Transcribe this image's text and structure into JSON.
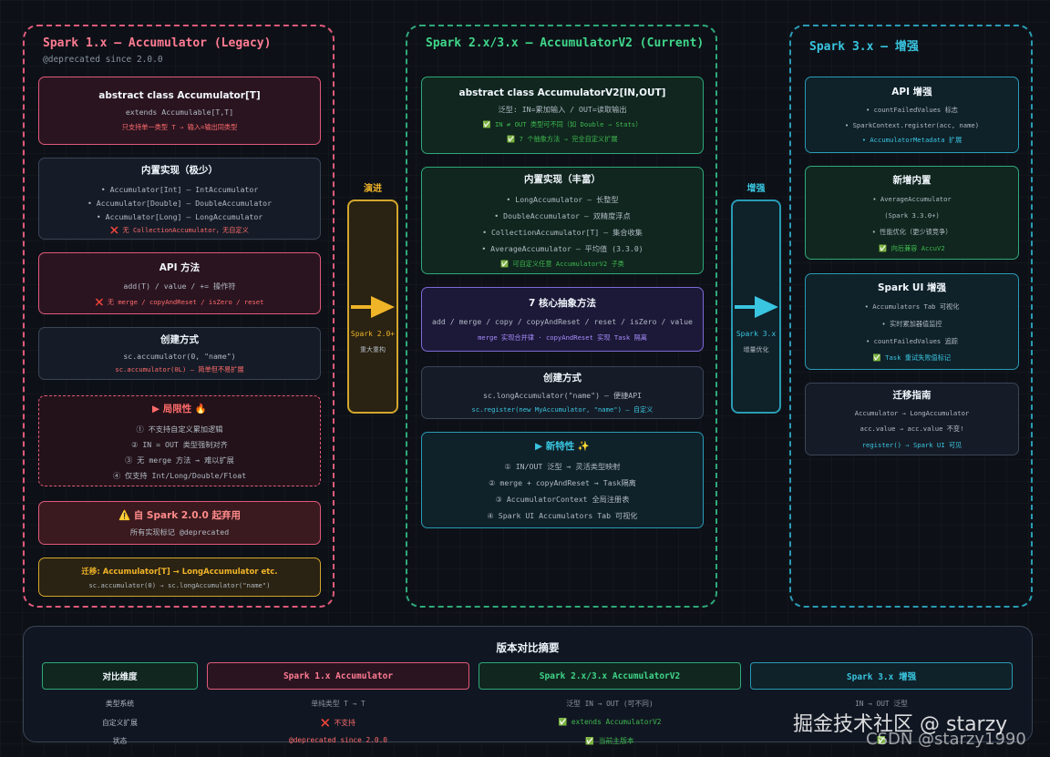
{
  "col1": {
    "title": "Spark 1.x — Accumulator (Legacy)",
    "subtitle": "@deprecated since 2.0.0",
    "card1": {
      "title": "abstract class Accumulator[T]",
      "line1": "extends Accumulable[T,T]",
      "note": "只支持单一类型 T → 输入=输出同类型"
    },
    "card2": {
      "title": "内置实现（极少）",
      "lines": [
        "• Accumulator[Int] — IntAccumulator",
        "• Accumulator[Double] — DoubleAccumulator",
        "• Accumulator[Long] — LongAccumulator"
      ],
      "note": "❌ 无 CollectionAccumulator，无自定义"
    },
    "card3": {
      "title": "API 方法",
      "line1": "add(T) / value / += 操作符",
      "note": "❌ 无 merge / copyAndReset / isZero / reset"
    },
    "card4": {
      "title": "创建方式",
      "line1": "sc.accumulator(0, \"name\")",
      "note": "sc.accumulator(0L) — 简单但不易扩展"
    },
    "card5": {
      "title": "▶ 局限性 🔥",
      "lines": [
        "① 不支持自定义累加逻辑",
        "② IN = OUT 类型强制对齐",
        "③ 无 merge 方法 → 难以扩展",
        "④ 仅支持 Int/Long/Double/Float"
      ]
    },
    "card6": {
      "title": "⚠️ 自 Spark 2.0.0 起弃用",
      "line1": "所有实现标记 @deprecated"
    },
    "card7": {
      "title": "迁移: Accumulator[T] → LongAccumulator etc.",
      "line1": "sc.accumulator(0) → sc.longAccumulator(\"name\")"
    }
  },
  "arrow1": {
    "label": "演进",
    "box_title": "Spark 2.0+",
    "box_sub": "重大重构"
  },
  "col2": {
    "title": "Spark 2.x/3.x — AccumulatorV2 (Current)",
    "card1": {
      "title": "abstract class AccumulatorV2[IN,OUT]",
      "line1": "泛型: IN=累加输入 / OUT=读取输出",
      "note1": "✅ IN ≠ OUT 类型可不同（如 Double → Stats）",
      "note2": "✅ 7 个抽象方法 → 完全自定义扩展"
    },
    "card2": {
      "title": "内置实现（丰富）",
      "lines": [
        "• LongAccumulator — 长整型",
        "• DoubleAccumulator — 双精度浮点",
        "• CollectionAccumulator[T] — 集合收集",
        "• AverageAccumulator — 平均值 (3.3.0)"
      ],
      "note": "✅ 可自定义任意 AccumulatorV2 子类"
    },
    "card3": {
      "title": "7 核心抽象方法",
      "line1": "add / merge / copy / copyAndReset / reset / isZero / value",
      "note": "merge 实现合并律 · copyAndReset 实现 Task 隔离"
    },
    "card4": {
      "title": "创建方式",
      "line1": "sc.longAccumulator(\"name\") — 便捷API",
      "note": "sc.register(new MyAccumulator, \"name\") — 自定义"
    },
    "card5": {
      "title": "▶ 新特性 ✨",
      "lines": [
        "① IN/OUT 泛型 → 灵活类型映射",
        "② merge + copyAndReset → Task隔离",
        "③ AccumulatorContext 全局注册表",
        "④ Spark UI Accumulators Tab 可视化"
      ]
    }
  },
  "arrow2": {
    "label": "增强",
    "box_title": "Spark 3.x",
    "box_sub": "增量优化"
  },
  "col3": {
    "title": "Spark 3.x — 增强",
    "card1": {
      "title": "API 增强",
      "lines": [
        "• countFailedValues 标志",
        "• SparkContext.register(acc, name)"
      ],
      "note": "• AccumulatorMetadata 扩展"
    },
    "card2": {
      "title": "新增内置",
      "lines": [
        "• AverageAccumulator",
        "(Spark 3.3.0+)",
        "• 性能优化（更少锁竞争）"
      ],
      "note": "✅ 向后兼容 AccuV2"
    },
    "card3": {
      "title": "Spark UI 增强",
      "lines": [
        "• Accumulators Tab 可视化",
        "• 实时累加器值监控",
        "• countFailedValues 追踪"
      ],
      "note": "✅ Task 重试失败值标记"
    },
    "card4": {
      "title": "迁移指南",
      "lines": [
        "Accumulator → LongAccumulator",
        "acc.value → acc.value 不变!"
      ],
      "note": "register() → Spark UI 可见"
    }
  },
  "summary": {
    "title": "版本对比摘要",
    "headers": [
      "对比维度",
      "Spark 1.x Accumulator",
      "Spark 2.x/3.x AccumulatorV2",
      "Spark 3.x 增强"
    ],
    "rows": [
      [
        "类型系统",
        "单纯类型 T → T",
        "泛型 IN → OUT (可不同)",
        "IN → OUT 泛型"
      ],
      [
        "自定义扩展",
        "❌ 不支持",
        "✅ extends AccumulatorV2",
        ""
      ],
      [
        "状态",
        "@deprecated since 2.0.0",
        "✅ 当前主版本",
        "✅"
      ]
    ]
  },
  "watermark": {
    "line1": "掘金技术社区 @ starzy",
    "line2": "CSDN @starzy1990"
  },
  "colors": {
    "red": "#ff6b6b",
    "green": "#3fb950",
    "cyan": "#39c5e0",
    "orange": "#f0b429",
    "purple": "#a78bfa"
  }
}
